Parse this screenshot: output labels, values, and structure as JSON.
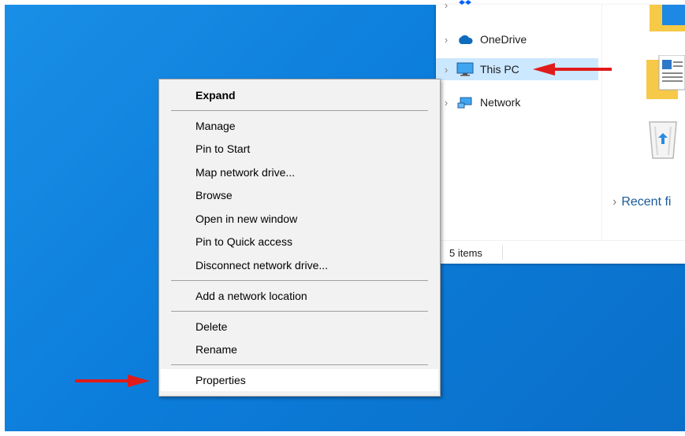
{
  "explorer": {
    "nav_items": [
      {
        "label": "OneDrive",
        "icon": "cloud-icon"
      },
      {
        "label": "This PC",
        "icon": "computer-icon"
      },
      {
        "label": "Network",
        "icon": "network-icon"
      }
    ],
    "recent_label": "Recent fi",
    "status_count": "5 items"
  },
  "context_menu": {
    "items": [
      "Expand",
      "Manage",
      "Pin to Start",
      "Map network drive...",
      "Browse",
      "Open in new window",
      "Pin to Quick access",
      "Disconnect network drive...",
      "Add a network location",
      "Delete",
      "Rename",
      "Properties"
    ]
  },
  "colors": {
    "desktop": "#0c7ddb",
    "selection": "#cce8ff",
    "menu_bg": "#f2f2f2",
    "arrow": "#e01b1b"
  }
}
